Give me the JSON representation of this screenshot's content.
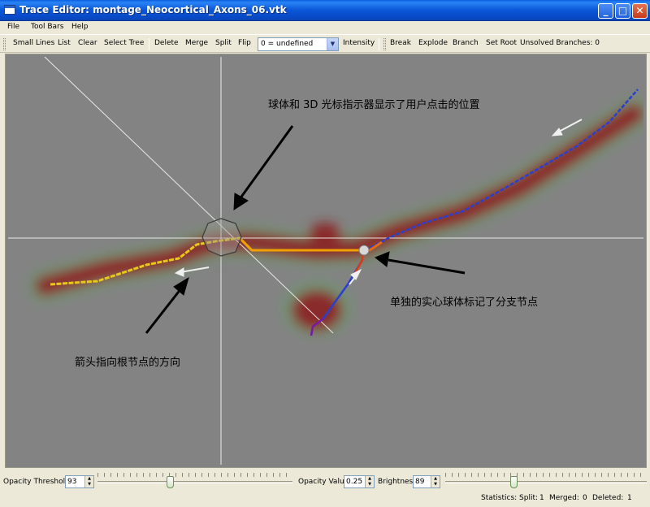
{
  "window": {
    "title": "Trace Editor: montage_Neocortical_Axons_06.vtk"
  },
  "menu": [
    "File",
    "Tool Bars",
    "Help"
  ],
  "toolbar": {
    "buttons": [
      "Small Lines",
      "List",
      "Clear",
      "Select Tree",
      "Delete",
      "Merge",
      "Split",
      "Flip"
    ],
    "type_select": "0 = undefined",
    "intensity": "Intensity",
    "buttons2": [
      "Break",
      "Explode",
      "Branch",
      "Set Root"
    ],
    "unsolved_branches": "Unsolved Branches: 0"
  },
  "annotations": {
    "cursor_note": "球体和 3D 光标指示器显示了用户点击的位置",
    "branch_note": "单独的实心球体标记了分支节点",
    "arrow_note": "箭头指向根节点的方向"
  },
  "controls": {
    "opacity_threshold": {
      "label": "Opacity Threshold",
      "value": "93"
    },
    "opacity_value": {
      "label": "Opacity Value",
      "value": "0.25"
    },
    "brightness": {
      "label": "Brightness",
      "value": "89"
    }
  },
  "statistics": {
    "split_label": "Statistics: Split:",
    "split": "1",
    "merged_label": "Merged:",
    "merged": "0",
    "deleted_label": "Deleted:",
    "deleted": "1"
  },
  "colors": {
    "titlebar": "#0a56d8",
    "background": "#838383",
    "glow_red": "#8b1e1e",
    "trace_yellow": "#e8c81a",
    "trace_orange": "#f0a000",
    "trace_blue": "#2a3fd0"
  }
}
